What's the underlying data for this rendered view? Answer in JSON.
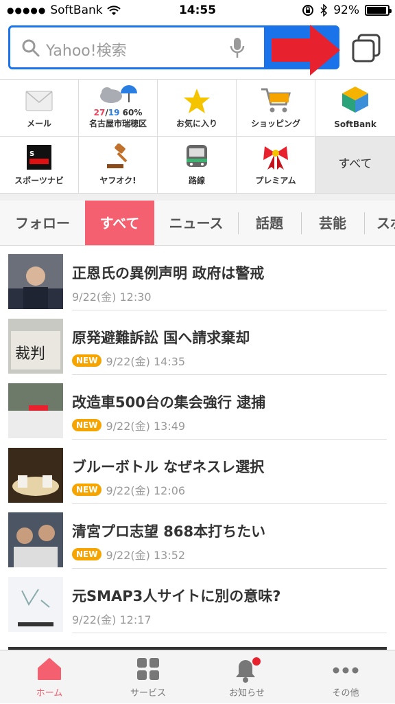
{
  "status": {
    "carrier": "SoftBank",
    "time": "14:55",
    "battery": "92%",
    "battery_level": 0.92
  },
  "search": {
    "placeholder": "Yahoo!検索"
  },
  "services": [
    {
      "label": "メール",
      "icon": "mail-icon"
    },
    {
      "label": "名古屋市瑞穂区",
      "icon": "weather-icon",
      "temp_hi": "27",
      "temp_lo": "19",
      "precip": "60%"
    },
    {
      "label": "お気に入り",
      "icon": "star-icon"
    },
    {
      "label": "ショッピング",
      "icon": "cart-icon"
    },
    {
      "label": "SoftBank",
      "icon": "softbank-cube-icon"
    },
    {
      "label": "スポーツナビ",
      "icon": "sportsnavi-icon"
    },
    {
      "label": "ヤフオク!",
      "icon": "auction-gavel-icon"
    },
    {
      "label": "路線",
      "icon": "train-icon"
    },
    {
      "label": "プレミアム",
      "icon": "ribbon-icon"
    },
    {
      "label": "すべて",
      "icon": ""
    }
  ],
  "topics": [
    "フォロー",
    "すべて",
    "ニュース",
    "話題",
    "芸能",
    "スポ"
  ],
  "news": [
    {
      "title": "正恩氏の異例声明 政府は警戒",
      "new": "",
      "time": "9/22(金) 12:30"
    },
    {
      "title": "原発避難訴訟 国へ請求棄却",
      "new": "NEW",
      "time": "9/22(金) 14:35"
    },
    {
      "title": "改造車500台の集会強行 逮捕",
      "new": "NEW",
      "time": "9/22(金) 13:49"
    },
    {
      "title": "ブルーボトル なぜネスレ選択",
      "new": "NEW",
      "time": "9/22(金) 12:06"
    },
    {
      "title": "清宮プロ志望 868本打ちたい",
      "new": "NEW",
      "time": "9/22(金) 13:52"
    },
    {
      "title": "元SMAP3人サイトに別の意味?",
      "new": "",
      "time": "9/22(金) 12:17"
    }
  ],
  "tabbar": [
    {
      "label": "ホーム",
      "icon": "home-icon"
    },
    {
      "label": "サービス",
      "icon": "grid-icon"
    },
    {
      "label": "お知らせ",
      "icon": "bell-icon"
    },
    {
      "label": "その他",
      "icon": "more-icon"
    }
  ],
  "colors": {
    "accent": "#f4606f",
    "search_blue": "#1a73e8",
    "arrow_red": "#e8212e",
    "new_badge": "#f5a400"
  }
}
